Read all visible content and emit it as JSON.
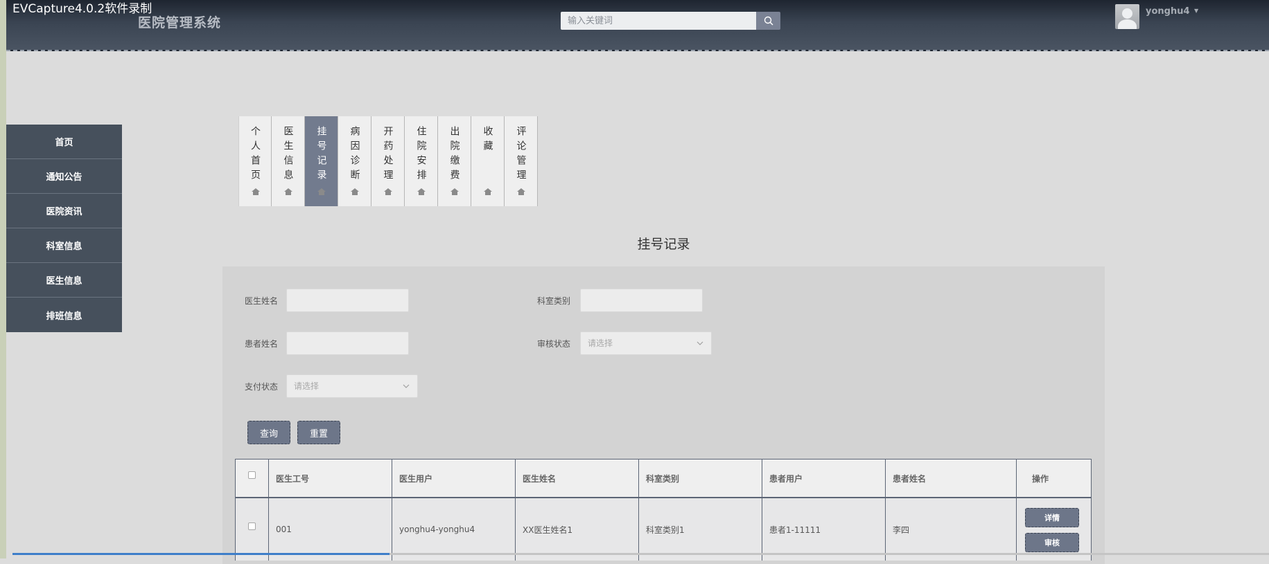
{
  "capture_label": "EVCapture4.0.2软件录制",
  "header": {
    "title": "医院管理系统",
    "search_placeholder": "输入关键词",
    "username": "yonghu4"
  },
  "sidebar": {
    "items": [
      "首页",
      "通知公告",
      "医院资讯",
      "科室信息",
      "医生信息",
      "排班信息"
    ]
  },
  "tabs": {
    "items": [
      {
        "label": "个人首页",
        "active": false
      },
      {
        "label": "医生信息",
        "active": false
      },
      {
        "label": "挂号记录",
        "active": true
      },
      {
        "label": "病因诊断",
        "active": false
      },
      {
        "label": "开药处理",
        "active": false
      },
      {
        "label": "住院安排",
        "active": false
      },
      {
        "label": "出院缴费",
        "active": false
      },
      {
        "label": "收藏",
        "active": false
      },
      {
        "label": "评论管理",
        "active": false
      }
    ]
  },
  "page_title": "挂号记录",
  "filters": {
    "doctor_name_label": "医生姓名",
    "dept_type_label": "科室类别",
    "patient_name_label": "患者姓名",
    "review_status_label": "审核状态",
    "review_status_placeholder": "请选择",
    "pay_status_label": "支付状态",
    "pay_status_placeholder": "请选择",
    "query_label": "查询",
    "reset_label": "重置"
  },
  "table": {
    "columns": [
      "医生工号",
      "医生用户",
      "医生姓名",
      "科室类别",
      "患者用户",
      "患者姓名"
    ],
    "ops_header": "操作",
    "rows": [
      {
        "cells": [
          "001",
          "yonghu4-yonghu4",
          "XX医生姓名1",
          "科室类别1",
          "患者1-11111",
          "李四"
        ],
        "detail_label": "详情",
        "review_label": "审核"
      }
    ]
  },
  "progress": {
    "value": 0.3
  },
  "colors": {
    "header_bg": "#3a4452",
    "sidebar_bg": "#46505c",
    "accent": "#6d7689",
    "active_tab": "#727b8e",
    "progress": "#3e7ec9"
  }
}
